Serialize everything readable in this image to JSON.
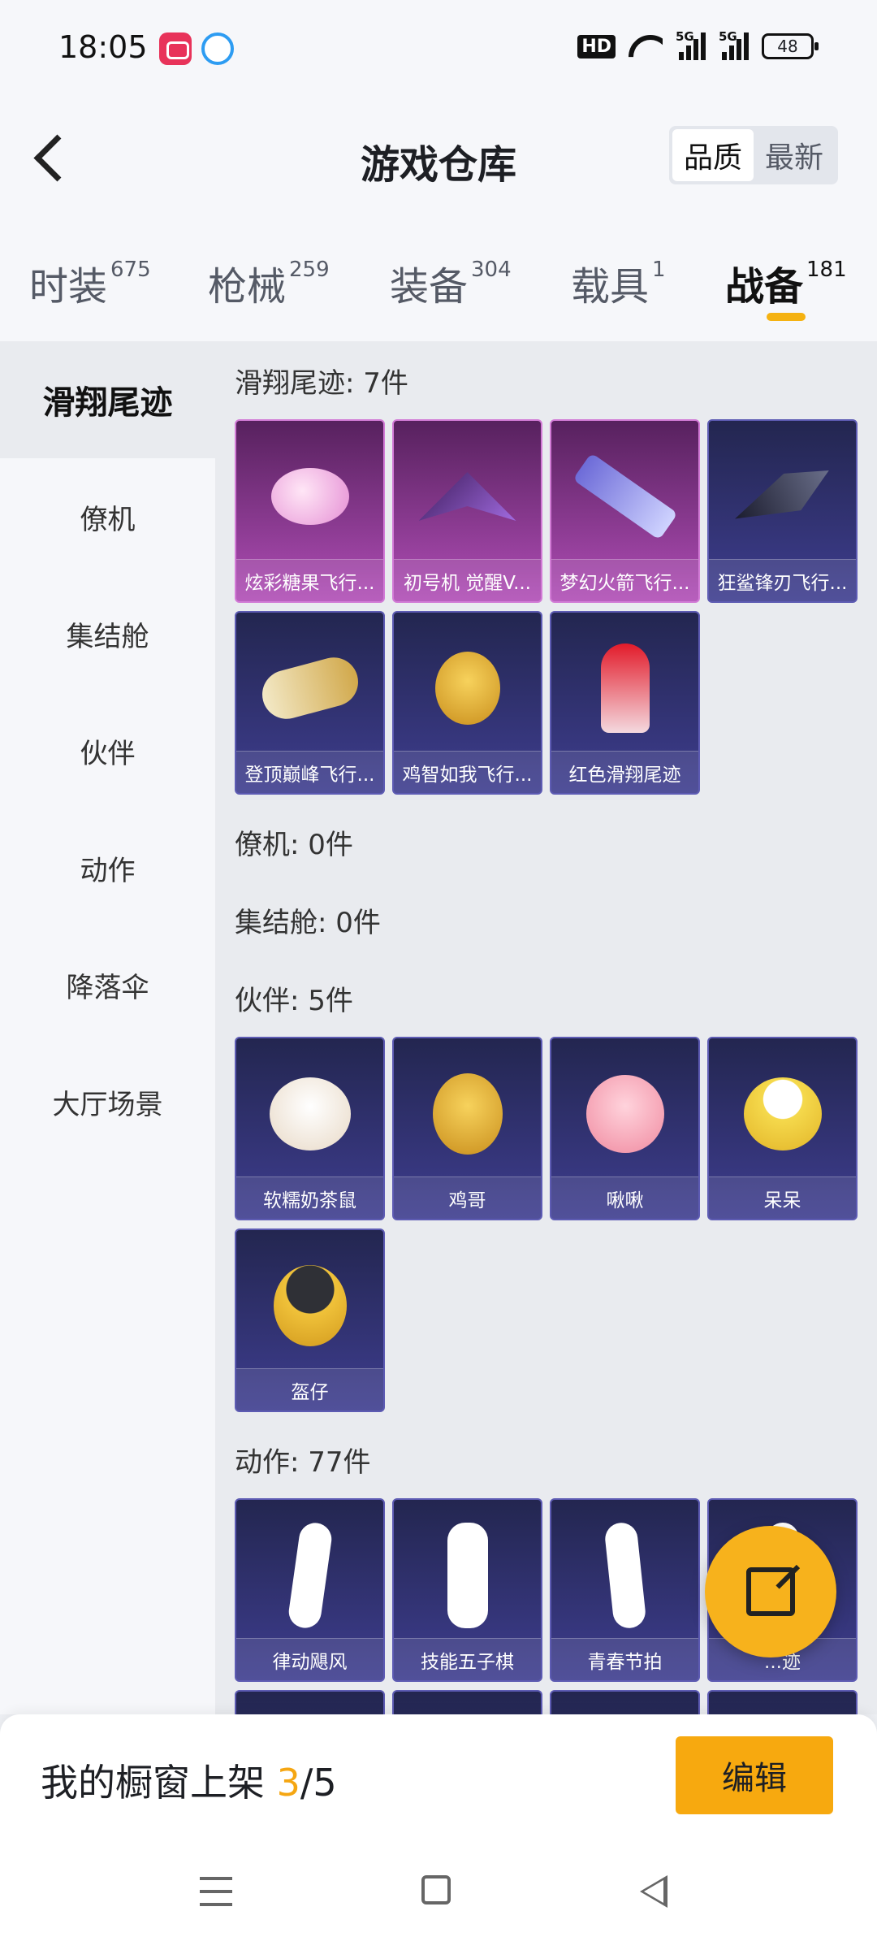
{
  "status_bar": {
    "time": "18:05",
    "hd": "HD",
    "net1": "5G",
    "net2": "5G",
    "battery": "48"
  },
  "header": {
    "title": "游戏仓库",
    "sort_quality": "品质",
    "sort_latest": "最新"
  },
  "tabs": [
    {
      "label": "时装",
      "count": "675"
    },
    {
      "label": "枪械",
      "count": "259"
    },
    {
      "label": "装备",
      "count": "304"
    },
    {
      "label": "载具",
      "count": "1"
    },
    {
      "label": "战备",
      "count": "181"
    }
  ],
  "sidebar": [
    "滑翔尾迹",
    "僚机",
    "集结舱",
    "伙伴",
    "动作",
    "降落伞",
    "大厅场景"
  ],
  "sections": {
    "glide": {
      "title": "滑翔尾迹: 7件",
      "items": [
        "炫彩糖果飞行...",
        "初号机 觉醒V...",
        "梦幻火箭飞行...",
        "狂鲨锋刃飞行...",
        "登顶巅峰飞行...",
        "鸡智如我飞行...",
        "红色滑翔尾迹"
      ]
    },
    "wingman": {
      "title": "僚机: 0件"
    },
    "pod": {
      "title": "集结舱: 0件"
    },
    "partner": {
      "title": "伙伴: 5件",
      "items": [
        "软糯奶茶鼠",
        "鸡哥",
        "啾啾",
        "呆呆",
        "盔仔"
      ]
    },
    "emote": {
      "title": "动作: 77件",
      "items": [
        "律动飓风",
        "技能五子棋",
        "青春节拍",
        "...迹"
      ]
    }
  },
  "showcase": {
    "prefix": "我的橱窗上架 ",
    "count": "3",
    "sep": "/",
    "total": "5"
  },
  "edit_label": "编辑",
  "colors": {
    "accent": "#f5b211",
    "card_purple": "#3e3d8f",
    "card_pink": "#b04db6"
  }
}
